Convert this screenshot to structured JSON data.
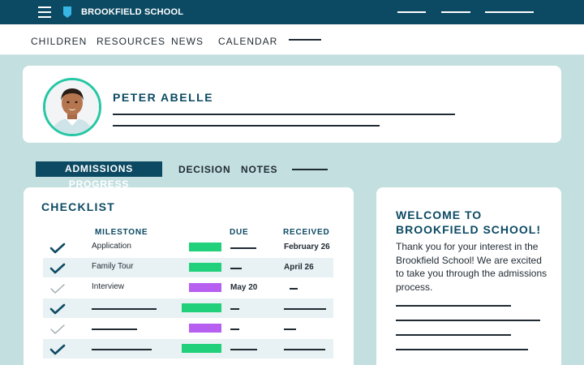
{
  "topbar": {
    "brand": "BROOKFIELD SCHOOL",
    "menu_icon": "hamburger-icon",
    "logo_icon": "shield-bookmark-icon",
    "bg_color": "#0c4a63"
  },
  "nav": {
    "items": [
      "CHILDREN",
      "RESOURCES",
      "NEWS",
      "CALENDAR"
    ]
  },
  "profile": {
    "name": "PETER ABELLE",
    "avatar_icon": "student-avatar",
    "ring_color": "#25c7a4"
  },
  "tabs": {
    "active": "ADMISSIONS PROGRESS",
    "items": [
      "DECISION",
      "NOTES"
    ]
  },
  "checklist": {
    "title": "CHECKLIST",
    "headers": {
      "milestone": "MILESTONE",
      "due": "DUE",
      "received": "RECEIVED"
    },
    "rows": [
      {
        "milestone": "Application",
        "due": "",
        "received": "February 26",
        "status": "complete",
        "bar_color": "#21d07a"
      },
      {
        "milestone": "Family Tour",
        "due": "",
        "received": "April 26",
        "status": "complete",
        "bar_color": "#21d07a"
      },
      {
        "milestone": "Interview",
        "due": "May 20",
        "received": "",
        "status": "pending",
        "bar_color": "#b65ff0"
      },
      {
        "milestone": "",
        "due": "",
        "received": "",
        "status": "complete",
        "bar_color": "#21d07a"
      },
      {
        "milestone": "",
        "due": "",
        "received": "",
        "status": "pending",
        "bar_color": "#b65ff0"
      },
      {
        "milestone": "",
        "due": "",
        "received": "",
        "status": "complete",
        "bar_color": "#21d07a"
      }
    ]
  },
  "welcome": {
    "title": "WELCOME TO BROOKFIELD SCHOOL!",
    "text": "Thank you for your interest in the Brookfield School! We are excited to take you through the admissions process."
  },
  "colors": {
    "background": "#c3dfe0",
    "accent": "#0c4a63",
    "shaded_row": "#e8f1f3"
  }
}
